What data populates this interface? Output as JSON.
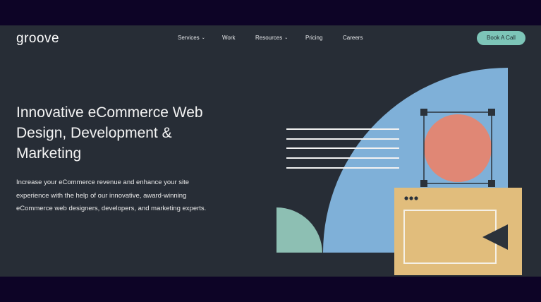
{
  "header": {
    "logo": "groove",
    "nav": [
      {
        "label": "Services",
        "has_dropdown": true
      },
      {
        "label": "Work",
        "has_dropdown": false
      },
      {
        "label": "Resources",
        "has_dropdown": true
      },
      {
        "label": "Pricing",
        "has_dropdown": false
      },
      {
        "label": "Careers",
        "has_dropdown": false
      }
    ],
    "cta_label": "Book A Call"
  },
  "hero": {
    "title_lines": [
      "Innovative eCommerce Web",
      "Design, Development &",
      "Marketing"
    ],
    "subtitle_lines": [
      "Increase your eCommerce revenue and enhance your site",
      "experience with the help of our innovative, award-winning",
      "eCommerce web designers, developers, and marketing experts."
    ]
  },
  "colors": {
    "outer_background": "#0d0426",
    "page_background": "#272d36",
    "accent_teal": "#7dc5b8",
    "illustration_blue": "#7fb0d8",
    "illustration_coral": "#e08775",
    "illustration_sand": "#e1bd7c",
    "illustration_mint": "#8dbfb3"
  },
  "icons": {
    "dropdown": "chevron-down-icon"
  }
}
